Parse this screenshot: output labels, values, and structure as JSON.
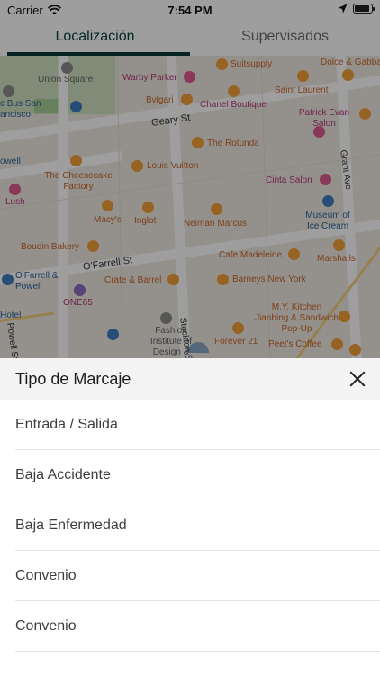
{
  "status_bar": {
    "carrier": "Carrier",
    "time": "7:54 PM",
    "battery_level": 0.9,
    "icons": [
      "wifi-icon",
      "location-arrow-icon",
      "battery-icon"
    ]
  },
  "tabs": [
    {
      "label": "Localización",
      "active": true
    },
    {
      "label": "Supervisados",
      "active": false
    }
  ],
  "map": {
    "streets": [
      "Geary St",
      "O'Farrell St",
      "Stockton St",
      "Grant Ave",
      "Powell St"
    ],
    "places": [
      "Union Square",
      "Suitsupply",
      "Dolce & Gabba",
      "Warby Parker",
      "Bvlgari",
      "Chanel Boutique",
      "Saint Laurent",
      "Patrick Evan Salon",
      "The Rotunda",
      "The Cheesecake Factory",
      "Louis Vuitton",
      "Cinta Salon",
      "Lush",
      "Macy's",
      "Inglot",
      "Neiman Marcus",
      "Museum of Ice Cream",
      "Boudin Bakery",
      "Cafe Madeleine",
      "Marshalls",
      "O'Farrell & Powell",
      "Crate & Barrel",
      "Barneys New York",
      "ONE65",
      "Hotel",
      "Fashion Institute of Design &",
      "M.Y. Kitchen Jianbing & Sandwich Pop-Up",
      "Forever 21",
      "Peet's Coffee",
      "c Bus San ancisco",
      "owell"
    ]
  },
  "sheet": {
    "title": "Tipo de Marcaje",
    "options": [
      "Entrada / Salida",
      "Baja Accidente",
      "Baja Enfermedad",
      "Convenio",
      "Convenio"
    ]
  },
  "colors": {
    "accent": "#0c3a3c",
    "map_background": "#efeae3",
    "dim_overlay": "rgba(0,0,0,0.38)"
  }
}
